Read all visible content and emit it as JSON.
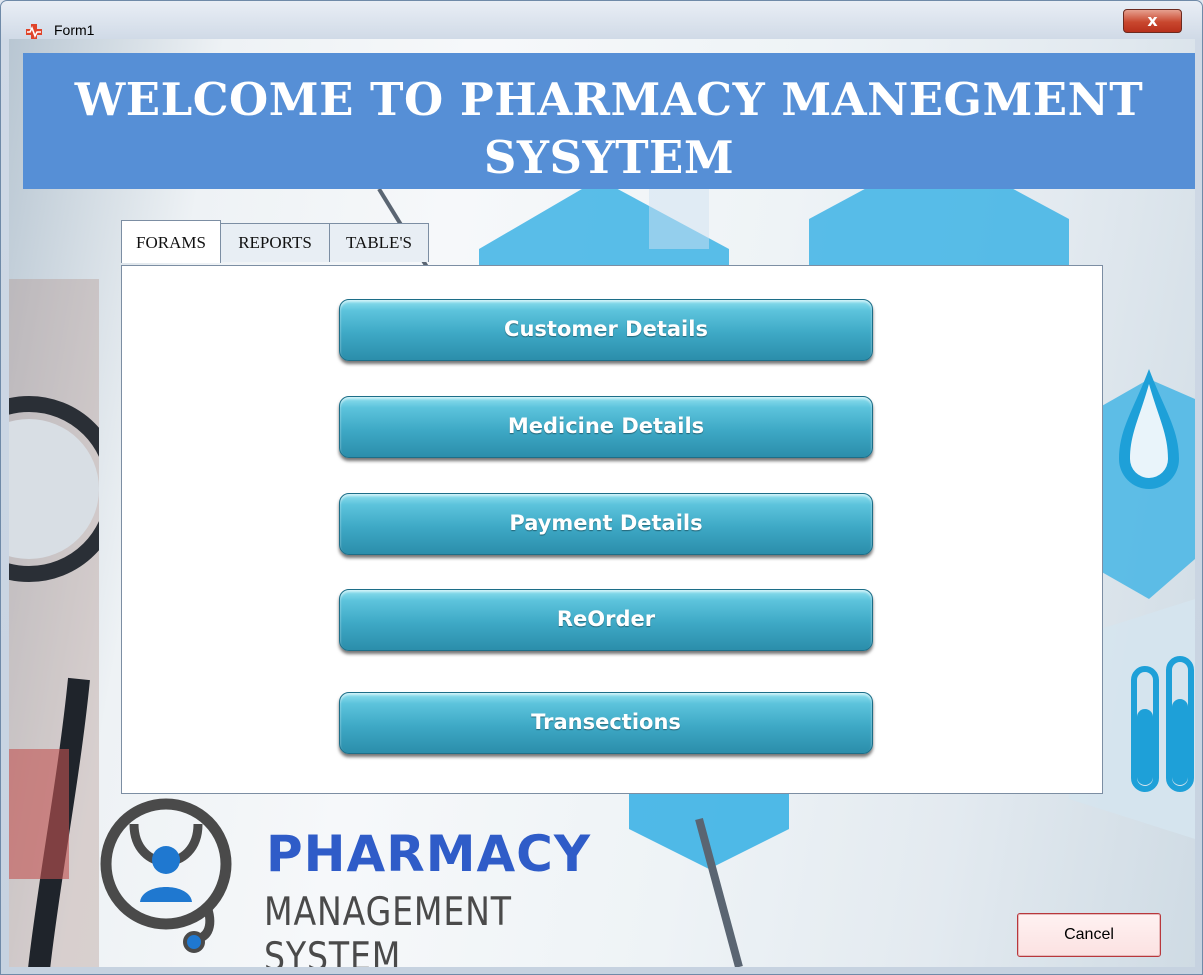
{
  "window": {
    "title": "Form1",
    "close_label": "x"
  },
  "header": {
    "title_line1": "WELCOME TO PHARMACY MANEGMENT",
    "title_line2": "SYSYTEM"
  },
  "tabs": [
    {
      "label": "FORAMS",
      "active": true
    },
    {
      "label": "REPORTS",
      "active": false
    },
    {
      "label": "TABLE'S",
      "active": false
    }
  ],
  "menu_buttons": [
    {
      "label": "Customer Details"
    },
    {
      "label": "Medicine Details"
    },
    {
      "label": "Payment Details"
    },
    {
      "label": "ReOrder"
    },
    {
      "label": "Transections"
    }
  ],
  "logo": {
    "word": "PHARMACY",
    "subtitle": "MANAGEMENT SYSTEM"
  },
  "footer": {
    "cancel_label": "Cancel"
  },
  "colors": {
    "header_bg": "#568fd6",
    "button_teal": "#3ea9c6",
    "logo_blue": "#2f5cc8"
  },
  "icons": [
    "app-cross-icon",
    "close-icon",
    "stethoscope-logo-icon"
  ]
}
